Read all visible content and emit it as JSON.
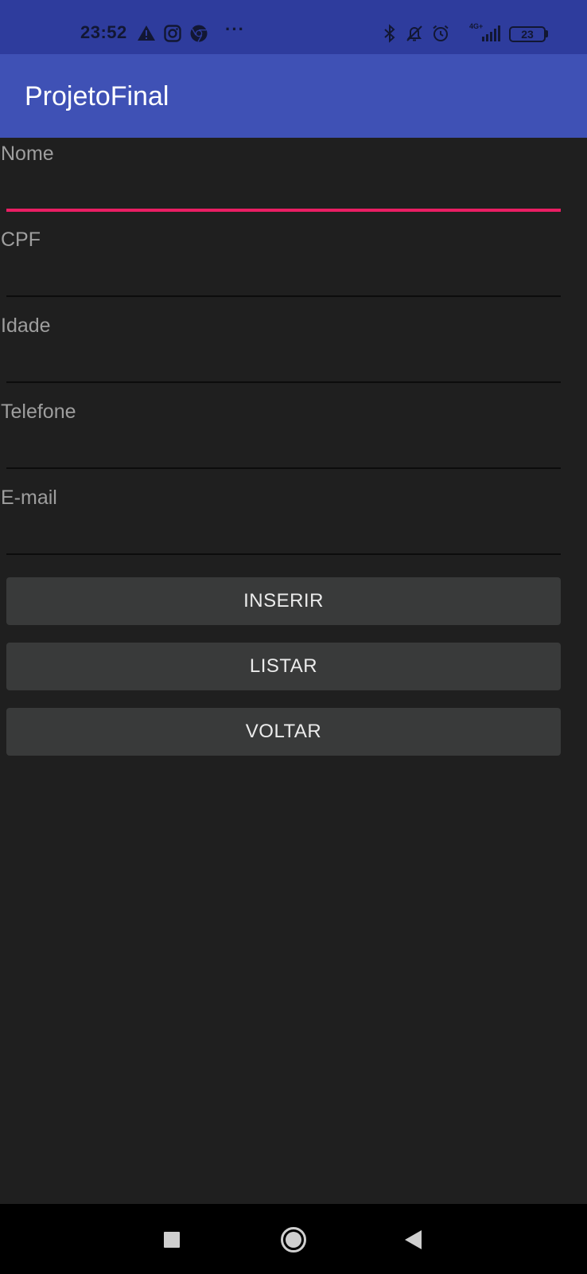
{
  "status_bar": {
    "time": "23:52",
    "left_icons": [
      "warning-icon",
      "instagram-icon",
      "chrome-icon"
    ],
    "more": "···",
    "right_icons": [
      "bluetooth-icon",
      "notifications-off-icon",
      "alarm-icon",
      "signal-icon"
    ],
    "network": "4G+",
    "battery": "23"
  },
  "app_bar": {
    "title": "ProjetoFinal"
  },
  "form": {
    "fields": [
      {
        "label": "Nome",
        "value": ""
      },
      {
        "label": "CPF",
        "value": ""
      },
      {
        "label": "Idade",
        "value": ""
      },
      {
        "label": "Telefone",
        "value": ""
      },
      {
        "label": "E-mail",
        "value": ""
      }
    ],
    "buttons": {
      "insert": "INSERIR",
      "list": "LISTAR",
      "back": "VOLTAR"
    }
  },
  "colors": {
    "status_bar": "#2e3c9d",
    "app_bar": "#3f51b5",
    "background": "#1f1f1f",
    "accent": "#e91e63",
    "button": "#393a3a"
  },
  "nav_bar": {
    "icons": [
      "recents-square-icon",
      "home-circle-icon",
      "back-triangle-icon"
    ]
  }
}
